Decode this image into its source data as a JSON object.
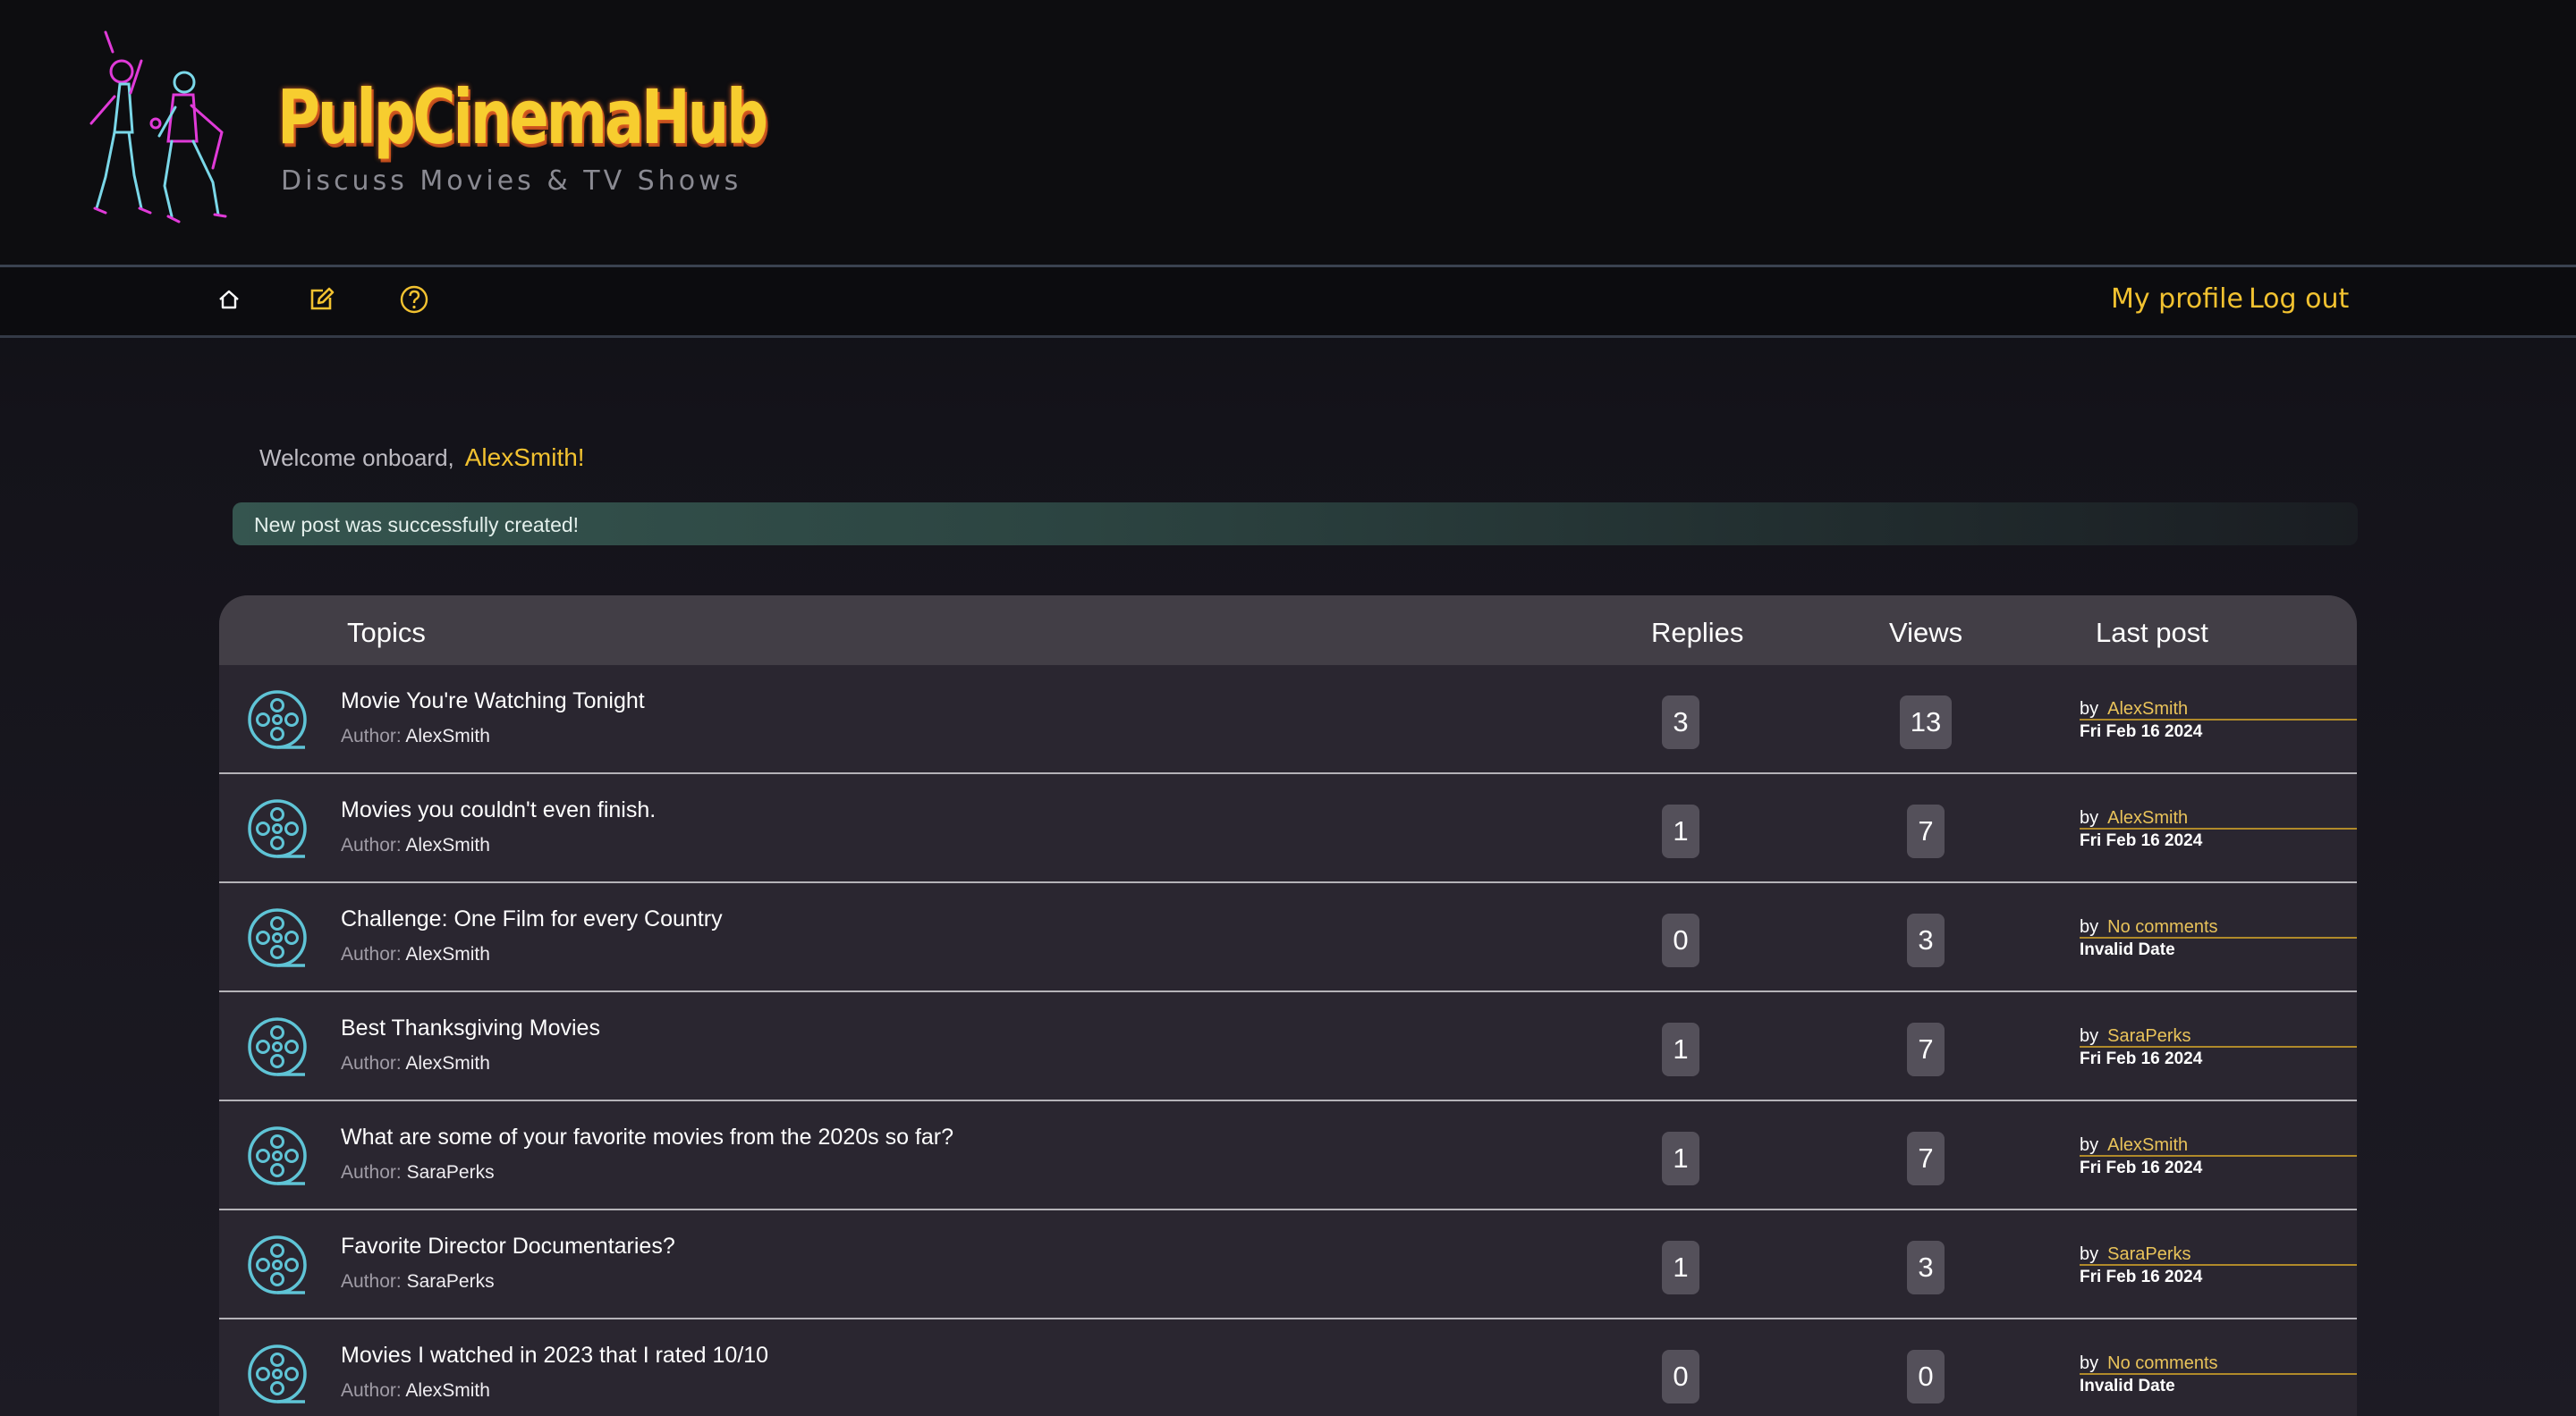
{
  "header": {
    "brand_title": "PulpCinemaHub",
    "brand_subtitle": "Discuss Movies & TV Shows"
  },
  "nav": {
    "icons": [
      "home-icon",
      "compose-icon",
      "help-icon"
    ],
    "my_profile": "My profile",
    "log_out": "Log out"
  },
  "welcome": {
    "prefix": "Welcome onboard,",
    "user": "AlexSmith!"
  },
  "flash": {
    "message": "New post was successfully created!"
  },
  "table": {
    "col_topics": "Topics",
    "col_replies": "Replies",
    "col_views": "Views",
    "col_last_post": "Last post",
    "author_label": "Author:",
    "by_label": "by",
    "rows": [
      {
        "title": "Movie You're Watching Tonight",
        "author": "AlexSmith",
        "replies": "3",
        "views": "13",
        "last_by": "AlexSmith",
        "last_date": "Fri Feb 16 2024"
      },
      {
        "title": "Movies you couldn't even finish.",
        "author": "AlexSmith",
        "replies": "1",
        "views": "7",
        "last_by": "AlexSmith",
        "last_date": "Fri Feb 16 2024"
      },
      {
        "title": "Challenge: One Film for every Country",
        "author": "AlexSmith",
        "replies": "0",
        "views": "3",
        "last_by": "No comments",
        "last_date": "Invalid Date"
      },
      {
        "title": "Best Thanksgiving Movies",
        "author": "AlexSmith",
        "replies": "1",
        "views": "7",
        "last_by": "SaraPerks",
        "last_date": "Fri Feb 16 2024"
      },
      {
        "title": "What are some of your favorite movies from the 2020s so far?",
        "author": "SaraPerks",
        "replies": "1",
        "views": "7",
        "last_by": "AlexSmith",
        "last_date": "Fri Feb 16 2024"
      },
      {
        "title": "Favorite Director Documentaries?",
        "author": "SaraPerks",
        "replies": "1",
        "views": "3",
        "last_by": "SaraPerks",
        "last_date": "Fri Feb 16 2024"
      },
      {
        "title": "Movies I watched in 2023 that I rated 10/10",
        "author": "AlexSmith",
        "replies": "0",
        "views": "0",
        "last_by": "No comments",
        "last_date": "Invalid Date"
      }
    ]
  },
  "colors": {
    "accent_yellow": "#f2c230",
    "reel_cyan": "#5fc4d6",
    "neon_pink": "#e03ad8",
    "success_green": "#35554f"
  }
}
